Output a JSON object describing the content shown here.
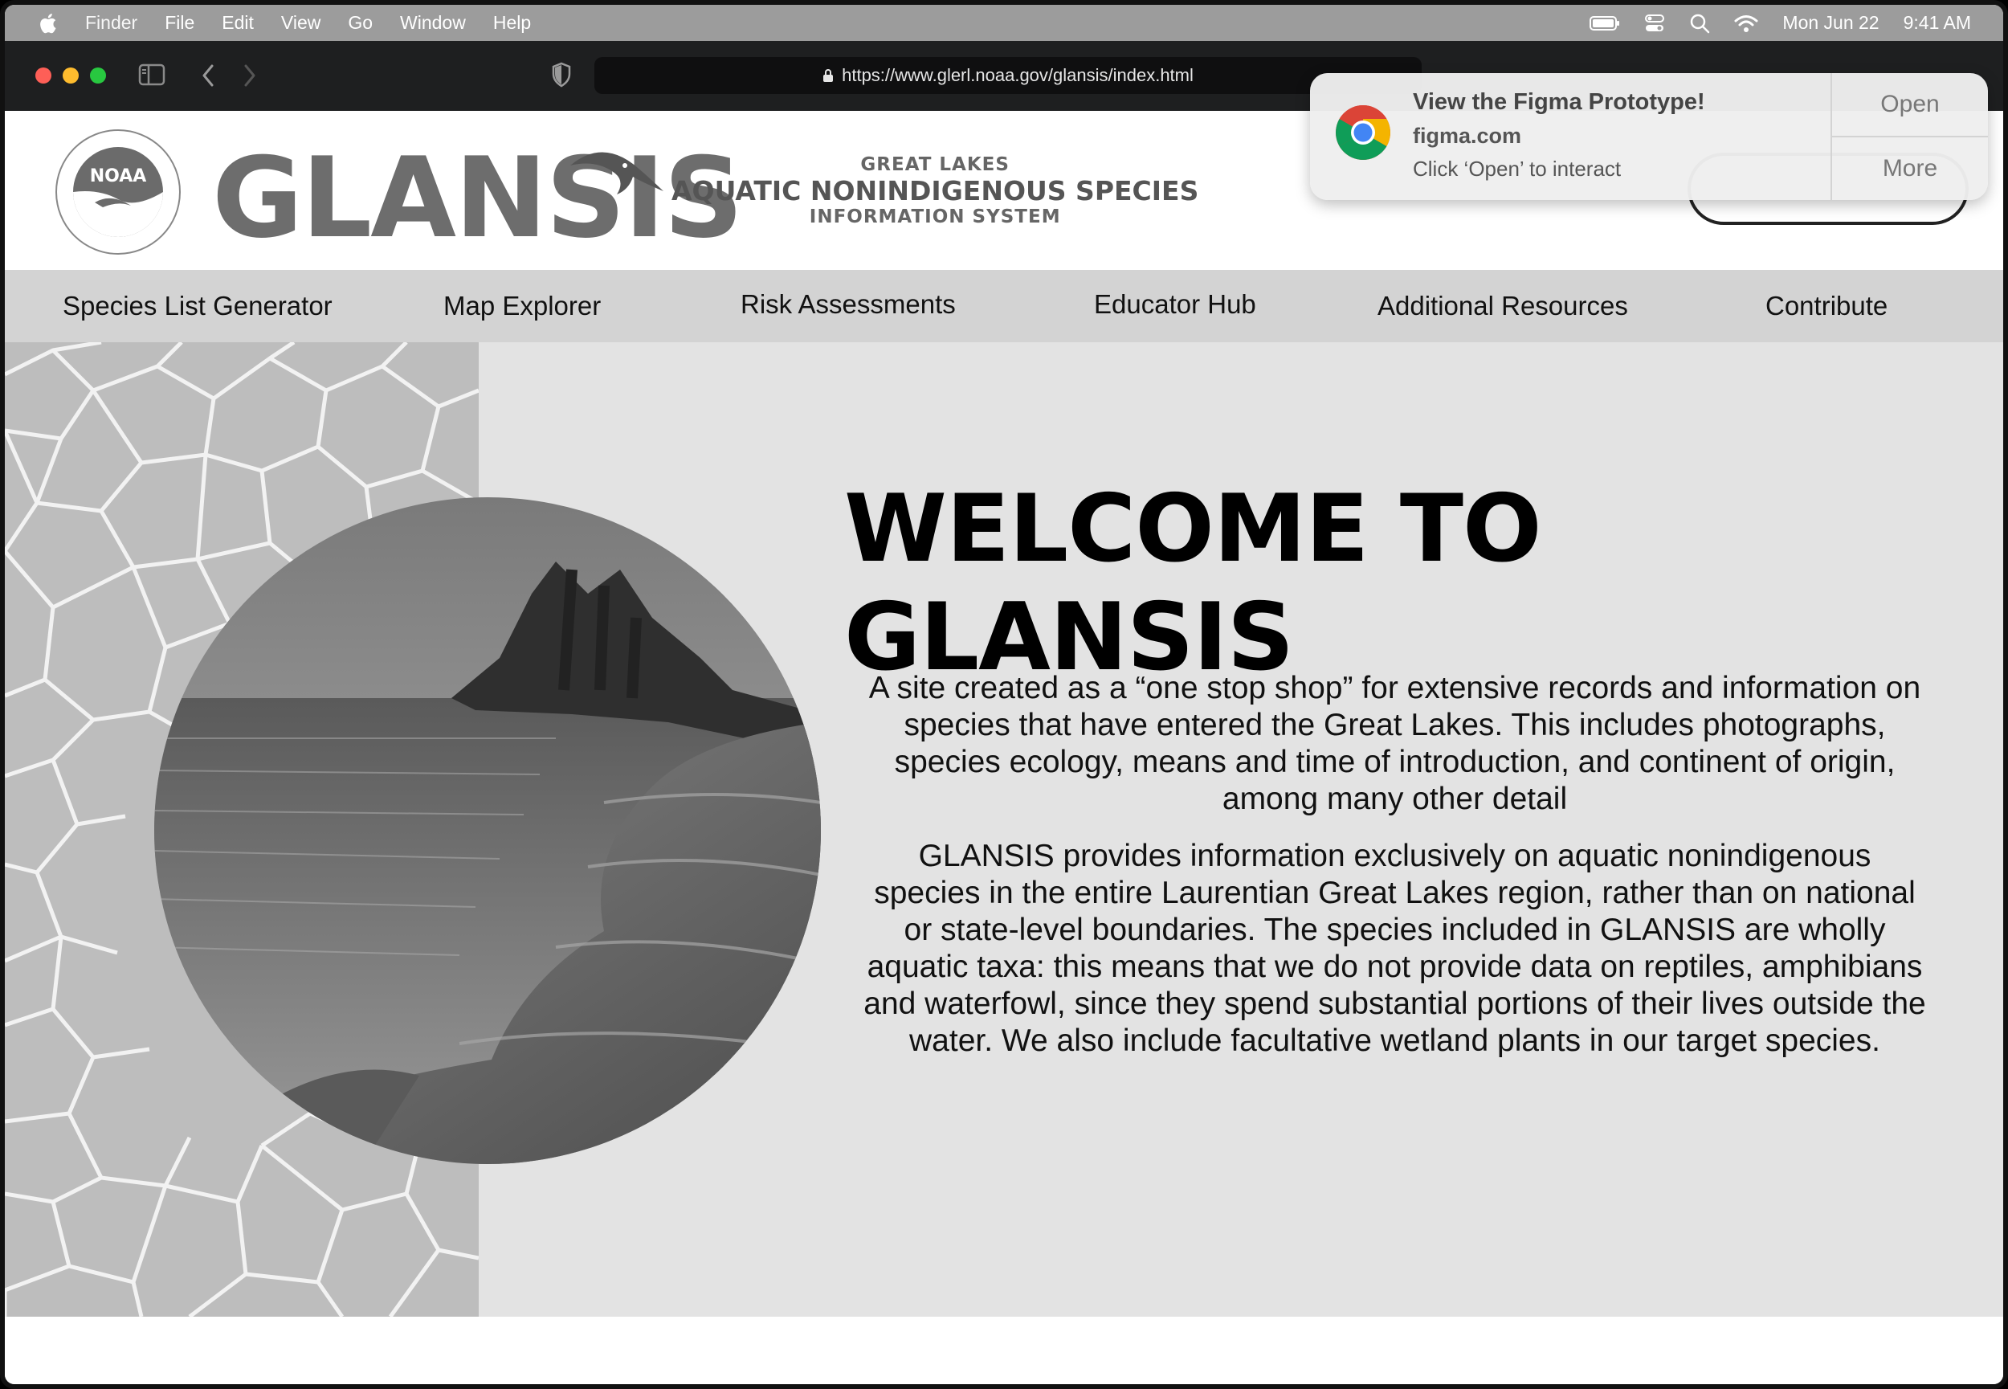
{
  "menubar": {
    "items": [
      "Finder",
      "File",
      "Edit",
      "View",
      "Go",
      "Window",
      "Help"
    ],
    "date": "Mon Jun 22",
    "time": "9:41 AM"
  },
  "browser": {
    "url": "https://www.glerl.noaa.gov/glansis/index.html"
  },
  "notification": {
    "title": "View the Figma Prototype!",
    "source": "figma.com",
    "body": "Click ‘Open’ to interact",
    "open_label": "Open",
    "more_label": "More"
  },
  "header": {
    "noaa_logo_text": "NOAA",
    "wordmark": "GLANSIS",
    "tagline_1": "GREAT LAKES",
    "tagline_2": "AQUATIC NONINDIGENOUS SPECIES",
    "tagline_3": "INFORMATION SYSTEM"
  },
  "nav": {
    "items": [
      "Species List Generator",
      "Map Explorer",
      "Risk Assessments",
      "Educator Hub",
      "Additional Resources",
      "Contribute"
    ]
  },
  "hero": {
    "headline": "WELCOME TO GLANSIS",
    "paragraph_1": "A site created as a “one stop shop” for extensive records and information on species that have entered the Great Lakes. This includes photographs, species ecology, means and time of introduction, and continent of origin, among many other detail",
    "paragraph_2": "GLANSIS provides information exclusively on aquatic nonindigenous species in the entire Laurentian Great Lakes region, rather than on national or state-level boundaries. The species included in GLANSIS are wholly aquatic taxa: this means that we do not provide data on reptiles, amphibians and waterfowl, since they spend substantial portions of their lives outside the water. We also include facultative wetland plants in our target species."
  }
}
